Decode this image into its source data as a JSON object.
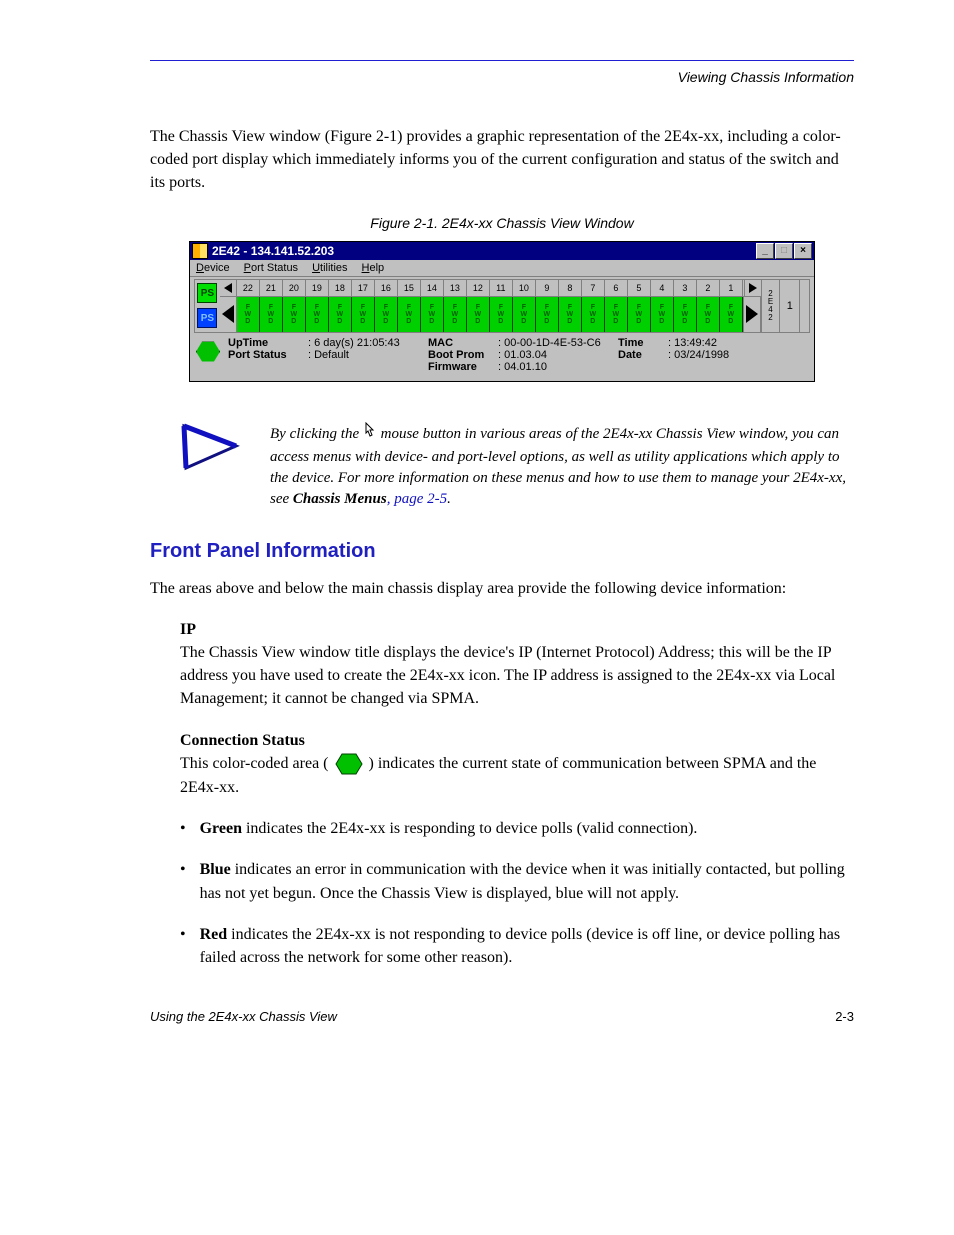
{
  "top_right": "Viewing Chassis Information",
  "intro_para": "The Chassis View window (Figure 2-1) provides a graphic representation of the 2E4x-xx, including a color-coded port display which immediately informs you of the current configuration and status of the switch and its ports.",
  "fig_caption": "Figure 2-1. 2E4x-xx Chassis View Window",
  "win_title": "2E42 - 134.141.52.203",
  "menus": [
    "Device",
    "Port Status",
    "Utilities",
    "Help"
  ],
  "menu_underline_index": [
    0,
    0,
    0,
    0
  ],
  "ps_labels": [
    "PS",
    "PS"
  ],
  "port_numbers": [
    22,
    21,
    20,
    19,
    18,
    17,
    16,
    15,
    14,
    13,
    12,
    11,
    10,
    9,
    8,
    7,
    6,
    5,
    4,
    3,
    2,
    1
  ],
  "port_state": "F\nW\nD",
  "dev_label": "2\nE\n4\n2",
  "slot_num": "1",
  "status": {
    "uptime_label": "UpTime",
    "uptime_value": ": 6 day(s) 21:05:43",
    "portstatus_label": "Port Status",
    "portstatus_value": ": Default",
    "mac_label": "MAC",
    "mac_value": ": 00-00-1D-4E-53-C6",
    "boot_label": "Boot Prom",
    "boot_value": ": 01.03.04",
    "fw_label": "Firmware",
    "fw_value": ": 04.01.10",
    "time_label": "Time",
    "time_value": ": 13:49:42",
    "date_label": "Date",
    "date_value": ": 03/24/1998"
  },
  "note_text_1": "By clicking the ",
  "note_text_2": " mouse button in various areas of the 2E4x-xx Chassis View window, you can access menus with device- and port-level options, as well as utility applications which apply to the device. For more information on these menus and how to use them to manage your 2E4x-xx, see ",
  "note_link": "Chassis Menus",
  "note_page_ref": ", page 2-5",
  "note_text_3": ".",
  "h2": "Front Panel Information",
  "fp_para": "The areas above and below the main chassis display area provide the following device information:",
  "ip_label": "IP",
  "ip_body_1": "The Chassis View window title displays the device's IP (Internet Protocol) Address; this will be the IP address you have used to create the 2E4x-xx icon. The IP address is assigned to the 2E4x-xx via Local Management; it cannot be changed via SPMA.",
  "conn_label": "Connection Status",
  "conn_body_1": "This color-coded area (",
  "conn_body_2": ") indicates the current state of communication between SPMA and the 2E4x-xx.",
  "bullets": [
    {
      "lead": "Green",
      "body": " indicates the 2E4x-xx is responding to device polls (valid connection)."
    },
    {
      "lead": "Blue",
      "body": " indicates an error in communication with the device when it was initially contacted, but polling has not yet begun. Once the Chassis View is displayed, blue will not apply."
    },
    {
      "lead": "Red",
      "body": " indicates the 2E4x-xx is not responding to device polls (device is off line, or device polling has failed across the network for some other reason)."
    }
  ],
  "footer_left": "Using the 2E4x-xx Chassis View",
  "footer_right": "2-3"
}
